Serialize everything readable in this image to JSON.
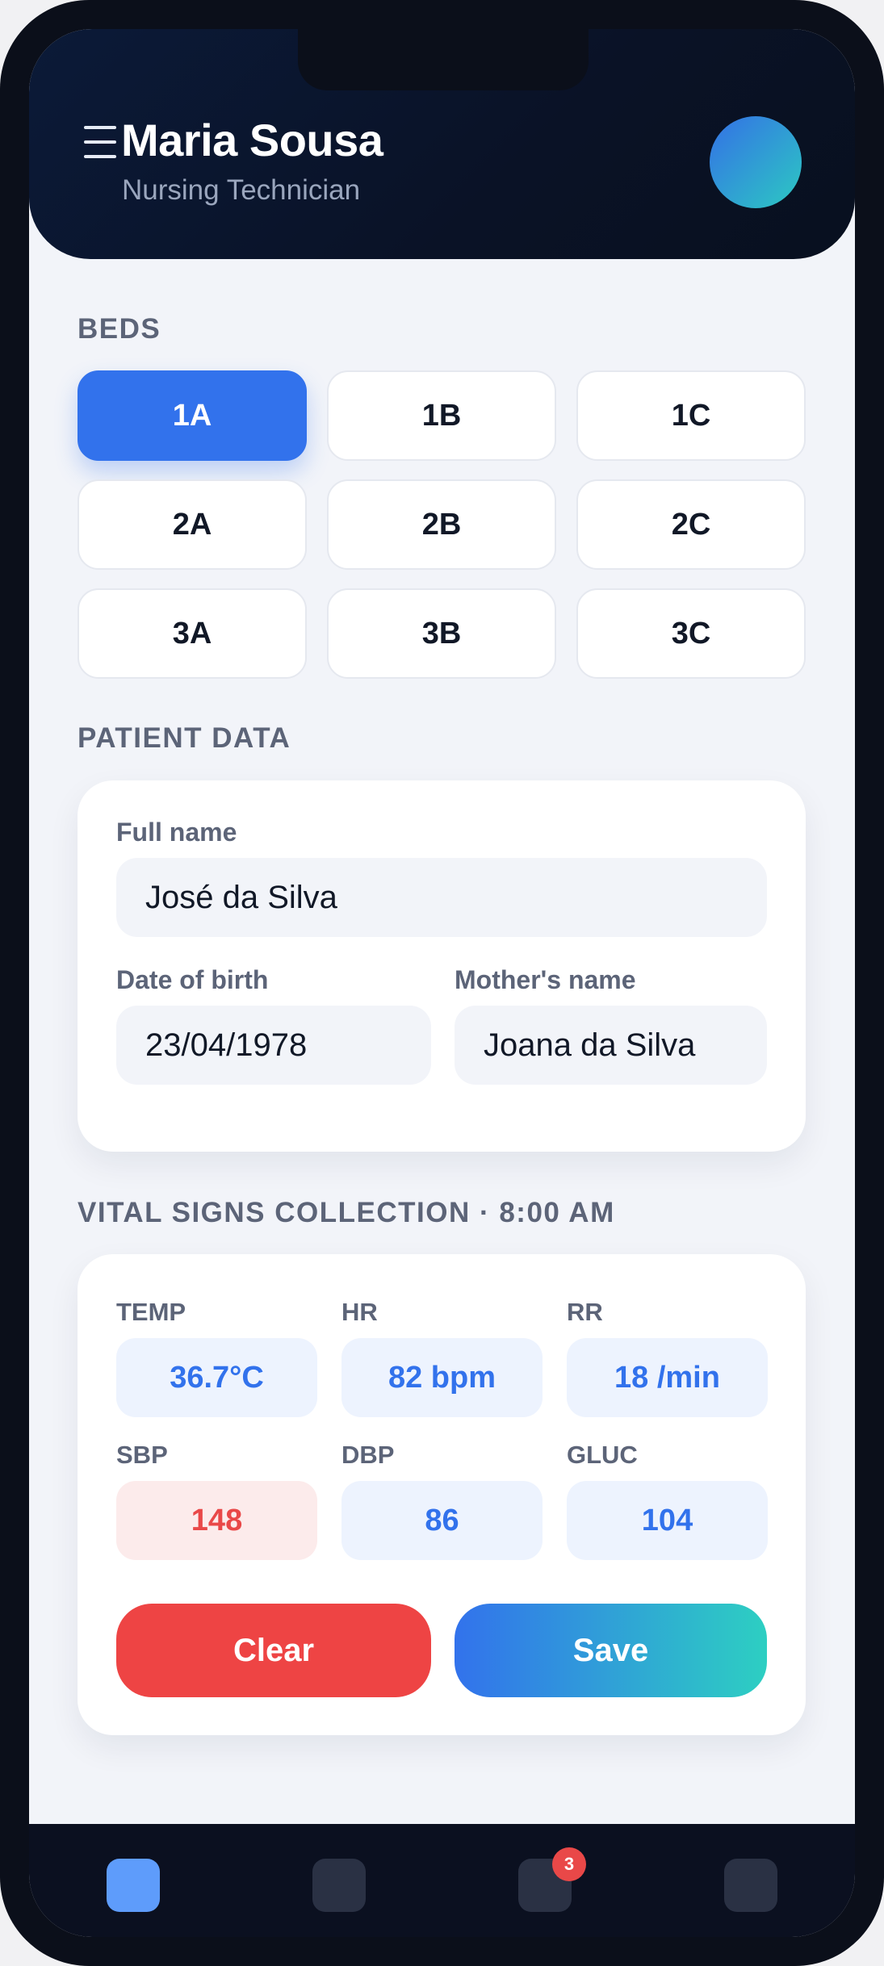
{
  "header": {
    "user_name": "Maria Sousa",
    "user_role": "Nursing Technician"
  },
  "beds": {
    "title": "BEDS",
    "selected": "1A",
    "items": [
      "1A",
      "1B",
      "1C",
      "2A",
      "2B",
      "2C",
      "3A",
      "3B",
      "3C"
    ]
  },
  "patient": {
    "title": "PATIENT DATA",
    "full_name_label": "Full name",
    "full_name": "José da Silva",
    "dob_label": "Date of birth",
    "dob": "23/04/1978",
    "mother_label": "Mother's name",
    "mother": "Joana da Silva"
  },
  "vitals": {
    "title": "VITAL SIGNS COLLECTION · 8:00 AM",
    "items": [
      {
        "label": "TEMP",
        "value": "36.7°C",
        "status": "normal"
      },
      {
        "label": "HR",
        "value": "82 bpm",
        "status": "normal"
      },
      {
        "label": "RR",
        "value": "18 /min",
        "status": "normal"
      },
      {
        "label": "SBP",
        "value": "148",
        "status": "alert"
      },
      {
        "label": "DBP",
        "value": "86",
        "status": "normal"
      },
      {
        "label": "GLUC",
        "value": "104",
        "status": "normal"
      }
    ],
    "clear_label": "Clear",
    "save_label": "Save"
  },
  "bottom_nav": {
    "items": [
      {
        "icon": "home-icon",
        "active": true
      },
      {
        "icon": "patients-icon",
        "active": false
      },
      {
        "icon": "notifications-icon",
        "active": false,
        "badge": "3"
      },
      {
        "icon": "profile-icon",
        "active": false
      }
    ]
  },
  "colors": {
    "primary": "#3272ec",
    "accent": "#2dcfc2",
    "danger": "#ee4444",
    "header_bg": "#0a1226"
  }
}
